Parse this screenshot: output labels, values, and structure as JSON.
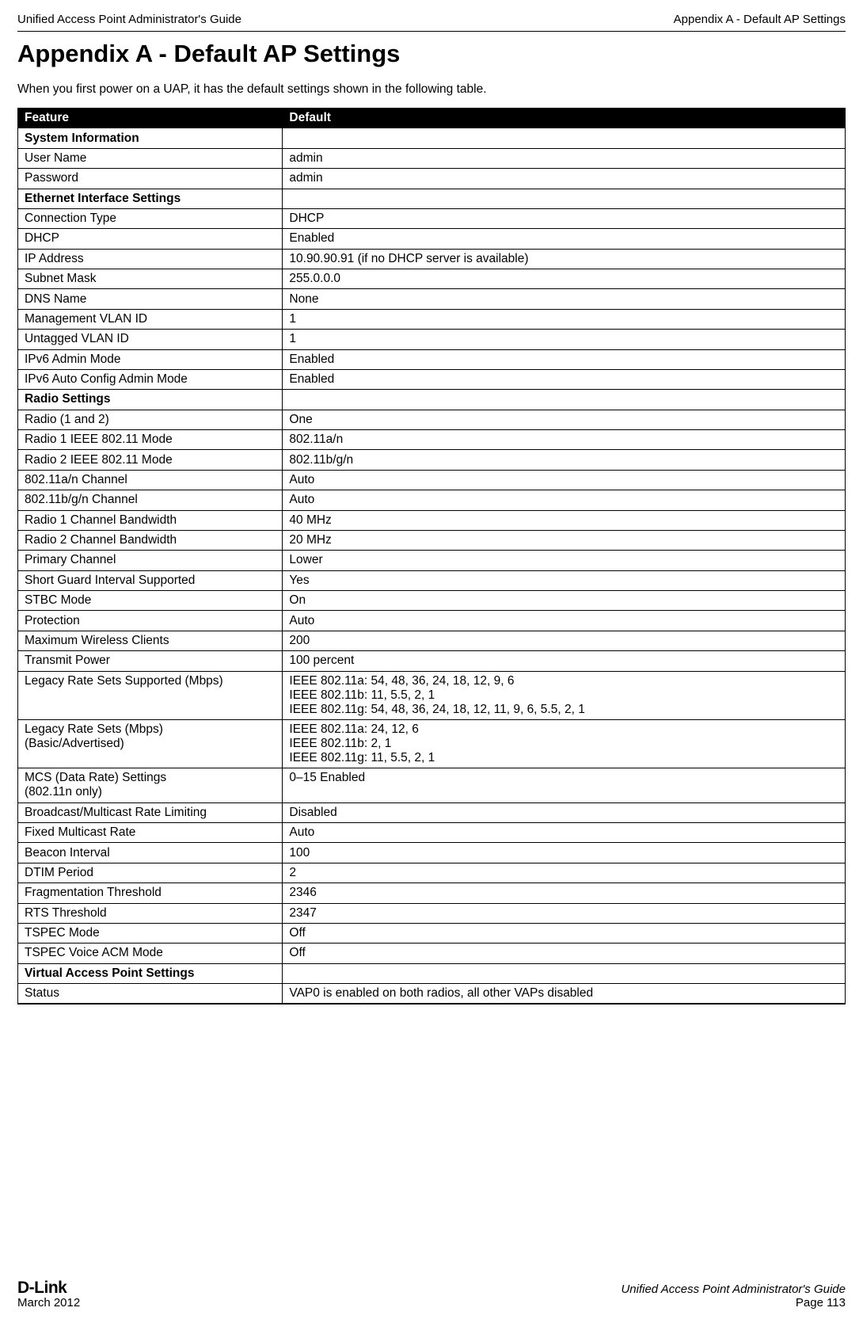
{
  "header": {
    "left": "Unified Access Point Administrator's Guide",
    "right": "Appendix A - Default AP Settings"
  },
  "title": "Appendix A - Default AP Settings",
  "intro": "When you first power on a UAP, it has the default settings shown in the following table.",
  "table": {
    "head": {
      "feature": "Feature",
      "default": "Default"
    },
    "rows": [
      {
        "type": "section",
        "feature": "System Information",
        "default": ""
      },
      {
        "type": "row",
        "feature": "User Name",
        "default": "admin"
      },
      {
        "type": "row",
        "feature": "Password",
        "default": "admin"
      },
      {
        "type": "section",
        "feature": "Ethernet Interface Settings",
        "default": ""
      },
      {
        "type": "row",
        "feature": "Connection Type",
        "default": "DHCP"
      },
      {
        "type": "row",
        "feature": "DHCP",
        "default": "Enabled"
      },
      {
        "type": "row",
        "feature": "IP Address",
        "default": "10.90.90.91 (if no DHCP server is available)"
      },
      {
        "type": "row",
        "feature": "Subnet Mask",
        "default": "255.0.0.0"
      },
      {
        "type": "row",
        "feature": "DNS Name",
        "default": "None"
      },
      {
        "type": "row",
        "feature": "Management VLAN ID",
        "default": "1"
      },
      {
        "type": "row",
        "feature": "Untagged VLAN ID",
        "default": "1"
      },
      {
        "type": "row",
        "feature": "IPv6 Admin Mode",
        "default": "Enabled"
      },
      {
        "type": "row",
        "feature": "IPv6 Auto Config Admin Mode",
        "default": "Enabled"
      },
      {
        "type": "section",
        "feature": "Radio Settings",
        "default": ""
      },
      {
        "type": "row",
        "feature": "Radio (1 and 2)",
        "default": "One"
      },
      {
        "type": "row",
        "feature": "Radio 1 IEEE 802.11 Mode",
        "default": "802.11a/n"
      },
      {
        "type": "row",
        "feature": "Radio 2 IEEE 802.11 Mode",
        "default": "802.11b/g/n"
      },
      {
        "type": "row",
        "feature": "802.11a/n Channel",
        "default": "Auto"
      },
      {
        "type": "row",
        "feature": "802.11b/g/n Channel",
        "default": "Auto"
      },
      {
        "type": "row",
        "feature": "Radio 1 Channel Bandwidth",
        "default": "40 MHz"
      },
      {
        "type": "row",
        "feature": "Radio 2 Channel Bandwidth",
        "default": "20 MHz"
      },
      {
        "type": "row",
        "feature": "Primary Channel",
        "default": "Lower"
      },
      {
        "type": "row",
        "feature": "Short Guard Interval Supported",
        "default": "Yes"
      },
      {
        "type": "row",
        "feature": "STBC Mode",
        "default": "On"
      },
      {
        "type": "row",
        "feature": "Protection",
        "default": "Auto"
      },
      {
        "type": "row",
        "feature": "Maximum Wireless Clients",
        "default": "200"
      },
      {
        "type": "row",
        "feature": "Transmit Power",
        "default": "100 percent"
      },
      {
        "type": "row",
        "feature": "Legacy Rate Sets Supported (Mbps)",
        "default": "IEEE 802.11a: 54, 48, 36, 24, 18, 12, 9, 6\nIEEE 802.11b: 11, 5.5, 2, 1\nIEEE 802.11g: 54, 48, 36, 24, 18, 12, 11, 9, 6, 5.5, 2, 1"
      },
      {
        "type": "row",
        "feature": "Legacy Rate Sets (Mbps)\n(Basic/Advertised)",
        "default": "IEEE 802.11a: 24, 12, 6\nIEEE 802.11b: 2, 1\nIEEE 802.11g: 11, 5.5, 2, 1"
      },
      {
        "type": "row",
        "feature": "MCS (Data Rate) Settings\n(802.11n only)",
        "default": "0–15 Enabled"
      },
      {
        "type": "row",
        "feature": "Broadcast/Multicast Rate Limiting",
        "default": "Disabled"
      },
      {
        "type": "row",
        "feature": "Fixed Multicast Rate",
        "default": "Auto"
      },
      {
        "type": "row",
        "feature": "Beacon Interval",
        "default": "100"
      },
      {
        "type": "row",
        "feature": "DTIM Period",
        "default": "2"
      },
      {
        "type": "row",
        "feature": "Fragmentation Threshold",
        "default": "2346"
      },
      {
        "type": "row",
        "feature": "RTS Threshold",
        "default": "2347"
      },
      {
        "type": "row",
        "feature": "TSPEC Mode",
        "default": "Off"
      },
      {
        "type": "row",
        "feature": "TSPEC Voice ACM Mode",
        "default": "Off"
      },
      {
        "type": "section",
        "feature": "Virtual Access Point Settings",
        "default": ""
      },
      {
        "type": "row",
        "feature": "Status",
        "default": "VAP0 is enabled on both radios, all other VAPs disabled"
      }
    ]
  },
  "footer": {
    "brand": "D-Link",
    "date": "March 2012",
    "guideTitle": "Unified Access Point Administrator's Guide",
    "page": "Page 113"
  }
}
